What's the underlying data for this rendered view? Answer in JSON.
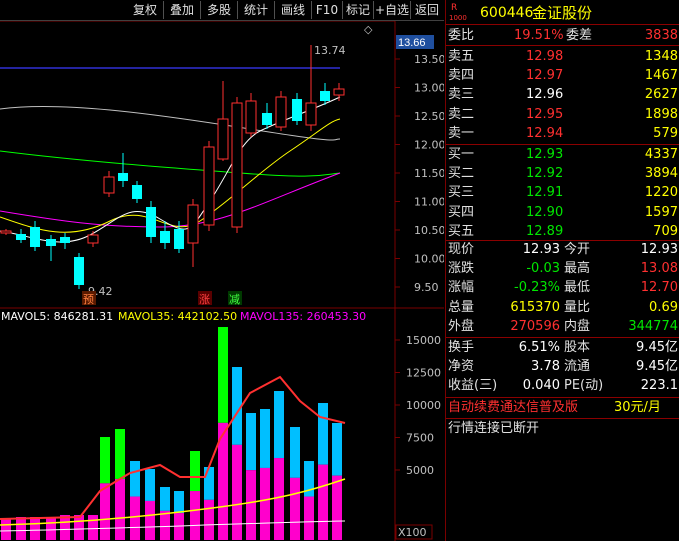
{
  "toolbar": {
    "buttons": [
      "复权",
      "叠加",
      "多股",
      "统计",
      "画线",
      "F10",
      "标记",
      "+自选",
      "返回"
    ],
    "menu_glyph": "◇"
  },
  "price_axis": {
    "ticks": [
      "13.50",
      "13.00",
      "12.50",
      "12.00",
      "11.50",
      "11.00",
      "10.50",
      "10.00",
      "9.50"
    ],
    "current": "13.66"
  },
  "annotations": {
    "high_label": "13.74",
    "low_label": "9.42",
    "tags": [
      "预",
      "涨",
      "减"
    ]
  },
  "volume": {
    "header_ma5": "MAVOL5: 846281.31",
    "header_ma35": "MAVOL35: 442102.50",
    "header_ma135": "MAVOL135: 260453.30",
    "ticks": [
      "15000",
      "12500",
      "10000",
      "7500",
      "5000"
    ],
    "unit": "X100"
  },
  "quote": {
    "code_prefix": "R",
    "code_sub": "1000",
    "code": "600446",
    "name": "金证股份",
    "weibi_label": "委比",
    "weibi": "19.51%",
    "weicha_label": "委差",
    "weicha": "3838",
    "asks": [
      {
        "label": "卖五",
        "price": "12.98",
        "vol": "1348"
      },
      {
        "label": "卖四",
        "price": "12.97",
        "vol": "1467"
      },
      {
        "label": "卖三",
        "price": "12.96",
        "vol": "2627"
      },
      {
        "label": "卖二",
        "price": "12.95",
        "vol": "1898"
      },
      {
        "label": "卖一",
        "price": "12.94",
        "vol": "579"
      }
    ],
    "bids": [
      {
        "label": "买一",
        "price": "12.93",
        "vol": "4337"
      },
      {
        "label": "买二",
        "price": "12.92",
        "vol": "3894"
      },
      {
        "label": "买三",
        "price": "12.91",
        "vol": "1220"
      },
      {
        "label": "买四",
        "price": "12.90",
        "vol": "1597"
      },
      {
        "label": "买五",
        "price": "12.89",
        "vol": "709"
      }
    ],
    "stats": [
      {
        "l1": "现价",
        "v1": "12.93",
        "l2": "今开",
        "v2": "12.93"
      },
      {
        "l1": "涨跌",
        "v1": "-0.03",
        "l2": "最高",
        "v2": "13.08"
      },
      {
        "l1": "涨幅",
        "v1": "-0.23%",
        "l2": "最低",
        "v2": "12.70"
      },
      {
        "l1": "总量",
        "v1": "615370",
        "l2": "量比",
        "v2": "0.69"
      },
      {
        "l1": "外盘",
        "v1": "270596",
        "l2": "内盘",
        "v2": "344774"
      }
    ],
    "stats2": [
      {
        "l1": "换手",
        "v1": "6.51%",
        "l2": "股本",
        "v2": "9.45亿"
      },
      {
        "l1": "净资",
        "v1": "3.78",
        "l2": "流通",
        "v2": "9.45亿"
      },
      {
        "l1": "收益(三)",
        "v1": "0.040",
        "l2": "PE(动)",
        "v2": "223.1"
      }
    ],
    "promo": "自动续费通达信普及版",
    "promo_price": "30元/月",
    "status": "行情连接已断开"
  },
  "colors": {
    "up": "#ff3030",
    "down": "#00ffff",
    "ma5": "#ffffff",
    "ma10": "#ffff00",
    "ma20": "#ff00ff",
    "ma60": "#00ff00",
    "ma120": "#c0c0c0"
  }
}
